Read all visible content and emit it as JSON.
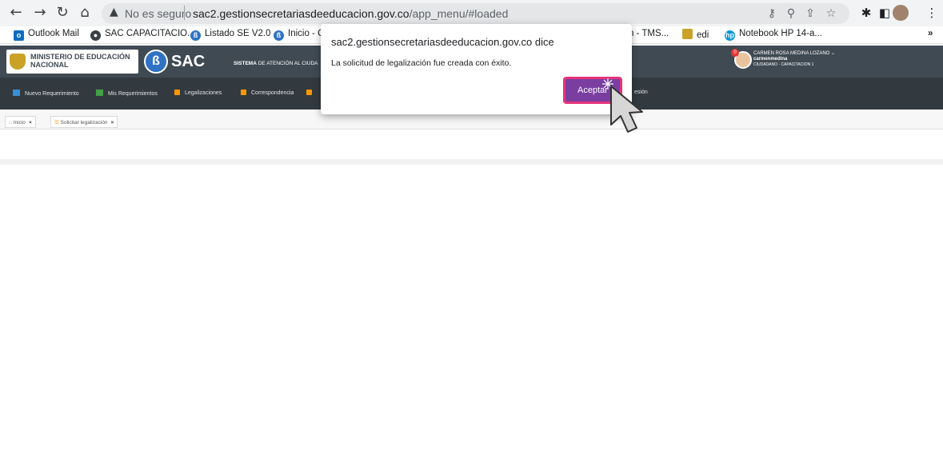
{
  "browser": {
    "insecure_label": "No es seguro",
    "url_host": "sac2.gestionsecretariasdeeducacion.gov.co",
    "url_path": "/app_menu/#loaded"
  },
  "bookmarks": [
    {
      "label": "Outlook Mail",
      "color": "#0f6cbd"
    },
    {
      "label": "SAC CAPACITACIO...",
      "color": "#3c4043"
    },
    {
      "label": "Listado SE V2.0",
      "color": "#3072c4"
    },
    {
      "label": "Inicio - C",
      "color": "#3072c4"
    },
    {
      "label": "ión - TMS...",
      "color": "#ffffff"
    },
    {
      "label": "edi",
      "color": "#c9a227"
    },
    {
      "label": "Notebook HP 14-a...",
      "color": "#0096d6"
    }
  ],
  "bookmarks_more": "»",
  "app": {
    "ministry_line1": "MINISTERIO DE EDUCACIÓN",
    "ministry_line2": "NACIONAL",
    "sac_label": "SAC",
    "system_title_bold": "SISTEMA",
    "system_title_rest": "DE ATENCIÓN AL CIUDA",
    "user_name": "CARMEN ROSA MEDINA LOZANO",
    "user_login": "carmenmedina",
    "user_role": "CIUDADANO - CAPACITACION 1",
    "notification_count": "0"
  },
  "menu": [
    {
      "label": "Nuevo Requerimiento",
      "color": "#3a8fd9"
    },
    {
      "label": "Mis Requerimientos",
      "color": "#43a047"
    },
    {
      "label": "Legalizaciones",
      "color": "#ff9800"
    },
    {
      "label": "Correspondencia",
      "color": "#ff9800"
    },
    {
      "label": "esión",
      "color": "#333a3f"
    }
  ],
  "tabs": [
    {
      "label": "Inicio"
    },
    {
      "label": "Solicitar legalización"
    }
  ],
  "dialog": {
    "title": "sac2.gestionsecretariasdeeducacion.gov.co dice",
    "message": "La solicitud de legalización fue creada con éxito.",
    "ok_button": "Aceptar"
  }
}
